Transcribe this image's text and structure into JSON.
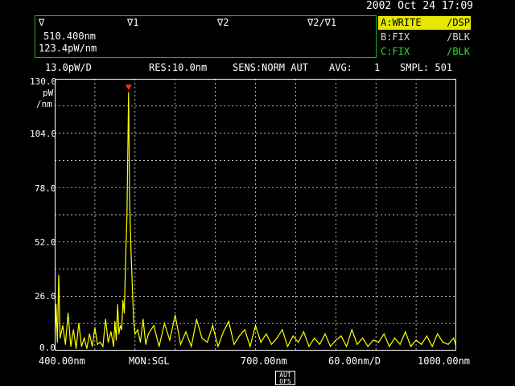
{
  "header": {
    "datetime": "2002 Oct 24 17:09"
  },
  "markers": {
    "col1_label": "∇",
    "col2_label": "∇1",
    "col3_label": "∇2",
    "col4_label": "∇2∕∇1",
    "wavelength": "510.400nm",
    "level": "123.4pW/nm"
  },
  "traces": [
    {
      "name": "A:WRITE",
      "mode": "/DSP"
    },
    {
      "name": "B:FIX",
      "mode": "/BLK"
    },
    {
      "name": "C:FIX",
      "mode": "/BLK"
    }
  ],
  "status": {
    "scale": "13.0pW/D",
    "res": "RES:10.0nm",
    "sens": "SENS:NORM AUT",
    "avg_label": "AVG:",
    "avg_value": "1",
    "smpl": "SMPL: 501"
  },
  "y_axis": {
    "ticks": [
      "130.0",
      "104.0",
      "78.0",
      "52.0",
      "26.0",
      "0.0"
    ],
    "unit1": "pW",
    "unit2": "/nm"
  },
  "bottom": {
    "start": "400.00nm",
    "mon": "MON:SGL",
    "center": "700.00nm",
    "span_div": "60.00nm/D",
    "stop": "1000.00nm"
  },
  "soft_key": {
    "line1": "AUT",
    "line2": "OFS"
  },
  "colors": {
    "trace": "#ffff00",
    "grid": "#ffffff",
    "marker": "#ff3300",
    "frame": "#1fb01f"
  },
  "chart_data": {
    "type": "line",
    "xlim": [
      400,
      1000
    ],
    "ylim": [
      0,
      130
    ],
    "x_unit": "nm",
    "y_unit": "pW/nm",
    "grid": true,
    "peak_marker": {
      "x": 510.4,
      "y": 123.4
    },
    "x": [
      400,
      402,
      404,
      406,
      408,
      412,
      416,
      420,
      424,
      428,
      432,
      436,
      440,
      444,
      448,
      452,
      456,
      460,
      464,
      468,
      472,
      476,
      480,
      484,
      488,
      490,
      492,
      494,
      496,
      498,
      500,
      502,
      504,
      506,
      508,
      510.4,
      512,
      514,
      516,
      518,
      520,
      524,
      528,
      532,
      536,
      540,
      548,
      556,
      564,
      572,
      580,
      588,
      596,
      604,
      612,
      620,
      628,
      636,
      644,
      652,
      660,
      668,
      676,
      684,
      692,
      700,
      708,
      716,
      724,
      732,
      740,
      748,
      756,
      764,
      772,
      780,
      788,
      796,
      804,
      812,
      820,
      828,
      836,
      844,
      852,
      860,
      868,
      876,
      884,
      892,
      900,
      908,
      916,
      924,
      932,
      940,
      948,
      956,
      964,
      972,
      980,
      988,
      996,
      1000
    ],
    "y": [
      2,
      22,
      4,
      36,
      6,
      12,
      3,
      18,
      2,
      10,
      1,
      13,
      2,
      6,
      1,
      8,
      2,
      11,
      3,
      4,
      2,
      15,
      4,
      9,
      2,
      14,
      5,
      22,
      8,
      12,
      10,
      24,
      18,
      45,
      65,
      123.4,
      72,
      48,
      30,
      14,
      8,
      10,
      4,
      15,
      3,
      8,
      12,
      2,
      13,
      5,
      17,
      3,
      9,
      2,
      15,
      6,
      4,
      12,
      2,
      9,
      14,
      3,
      7,
      10,
      2,
      12,
      4,
      8,
      3,
      6,
      10,
      2,
      7,
      4,
      9,
      2,
      6,
      3,
      8,
      2,
      5,
      7,
      2,
      10,
      3,
      6,
      2,
      5,
      4,
      8,
      2,
      6,
      3,
      9,
      2,
      5,
      3,
      7,
      2,
      8,
      4,
      3,
      6,
      2
    ]
  }
}
